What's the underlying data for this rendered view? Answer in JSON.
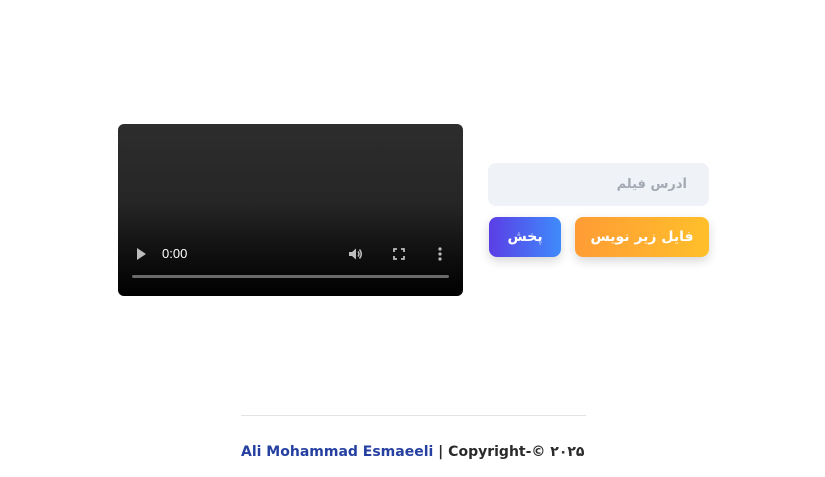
{
  "video": {
    "time": "0:00",
    "icons": [
      "play-icon",
      "volume-icon",
      "fullscreen-icon",
      "more-options-icon"
    ]
  },
  "form": {
    "url_placeholder": "آدرس فیلم",
    "subtitle_button": "فایل زیر نویس",
    "play_button": "پخش"
  },
  "footer": {
    "author": "Ali Mohammad Esmaeeli",
    "copyright": " | Copyright-© ۲۰۲۵"
  },
  "colors": {
    "subtitle_button_gradient": [
      "#ff9c35",
      "#ffbf2a"
    ],
    "play_button_gradient": [
      "#5b3ee6",
      "#3f8bfb"
    ],
    "author_link": "#2540a0",
    "input_background": "#eff2f7"
  }
}
